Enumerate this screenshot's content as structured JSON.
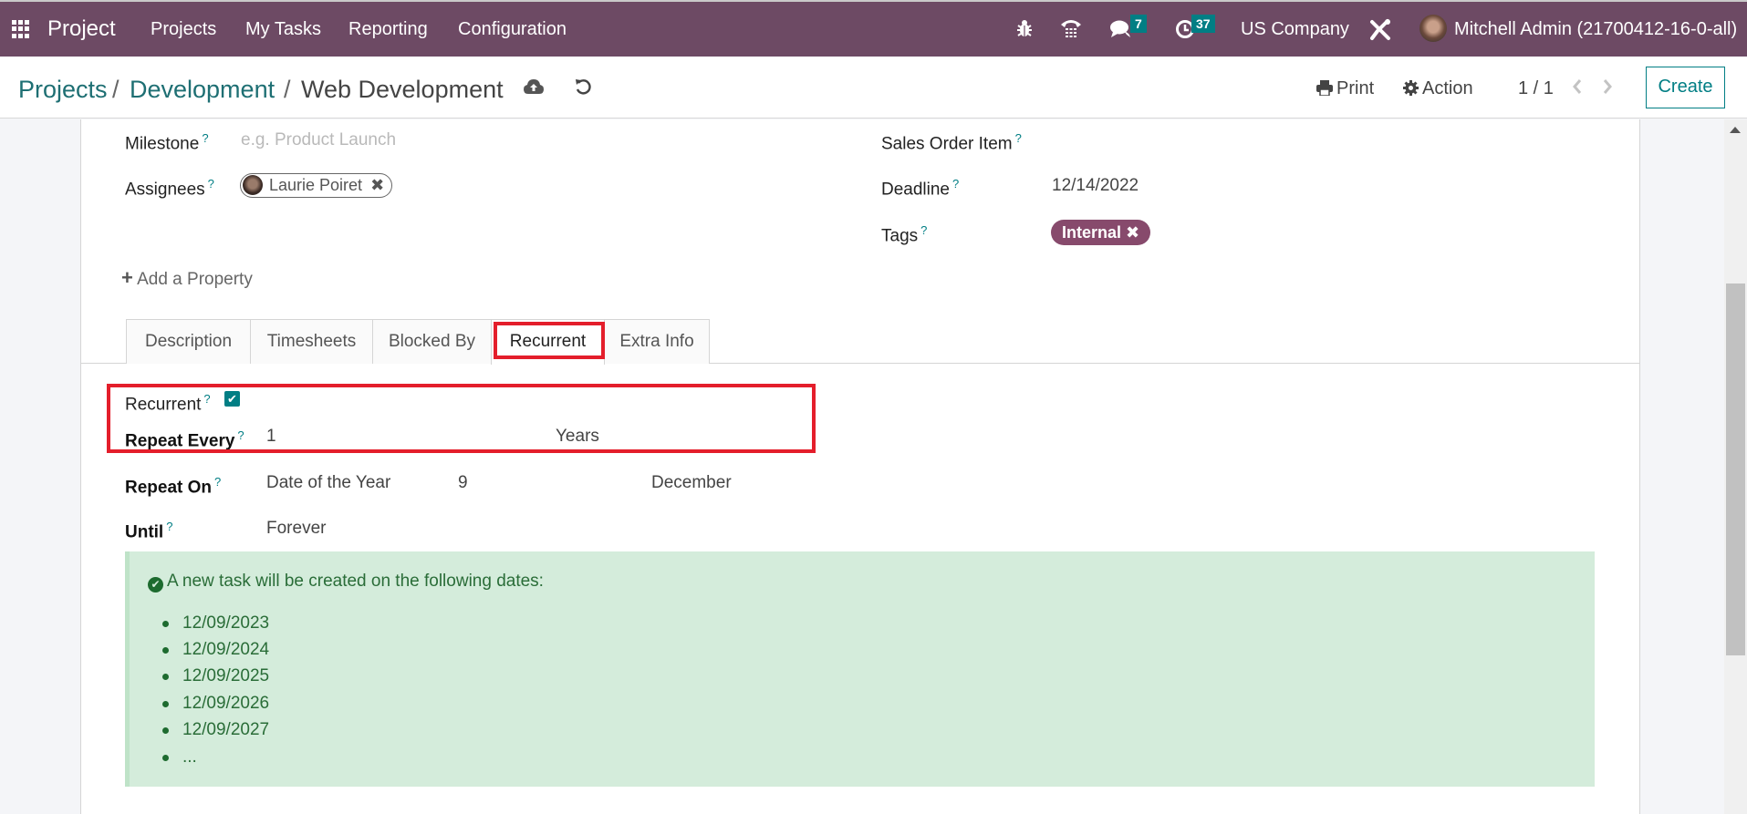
{
  "navbar": {
    "app_name": "Project",
    "menu": [
      "Projects",
      "My Tasks",
      "Reporting",
      "Configuration"
    ],
    "messages_count": "7",
    "activities_count": "37",
    "company": "US Company",
    "user": "Mitchell Admin (21700412-16-0-all)",
    "colors": {
      "bar": "#6d4a64",
      "badge": "#017e84"
    }
  },
  "breadcrumb": {
    "items": [
      "Projects",
      "Development"
    ],
    "separator": "/",
    "current": "Web Development"
  },
  "control_panel": {
    "print_label": "Print",
    "action_label": "Action",
    "pager": "1 / 1",
    "create_label": "Create"
  },
  "form": {
    "milestone": {
      "label": "Milestone",
      "placeholder": "e.g. Product Launch"
    },
    "assignees": {
      "label": "Assignees",
      "values": [
        "Laurie Poiret"
      ]
    },
    "sales_order_item": {
      "label": "Sales Order Item",
      "value": ""
    },
    "deadline": {
      "label": "Deadline",
      "value": "12/14/2022"
    },
    "tags": {
      "label": "Tags",
      "values": [
        "Internal"
      ],
      "color": "#874a6c"
    },
    "help_mark": "?",
    "add_property_label": "Add a Property"
  },
  "tabs": {
    "items": [
      "Description",
      "Timesheets",
      "Blocked By",
      "Recurrent",
      "Extra Info"
    ],
    "active": "Recurrent"
  },
  "recurrence": {
    "recurrent": {
      "label": "Recurrent",
      "checked": true
    },
    "repeat_every": {
      "label": "Repeat Every",
      "interval": "1",
      "unit": "Years"
    },
    "repeat_on": {
      "label": "Repeat On",
      "mode": "Date of the Year",
      "day": "9",
      "month": "December"
    },
    "until": {
      "label": "Until",
      "value": "Forever"
    }
  },
  "alert": {
    "heading": "A new task will be created on the following dates:",
    "dates": [
      "12/09/2023",
      "12/09/2024",
      "12/09/2025",
      "12/09/2026",
      "12/09/2027",
      "..."
    ],
    "color": "#d4ecdb"
  },
  "annotations": {
    "highlight_color": "#e41e2b"
  }
}
